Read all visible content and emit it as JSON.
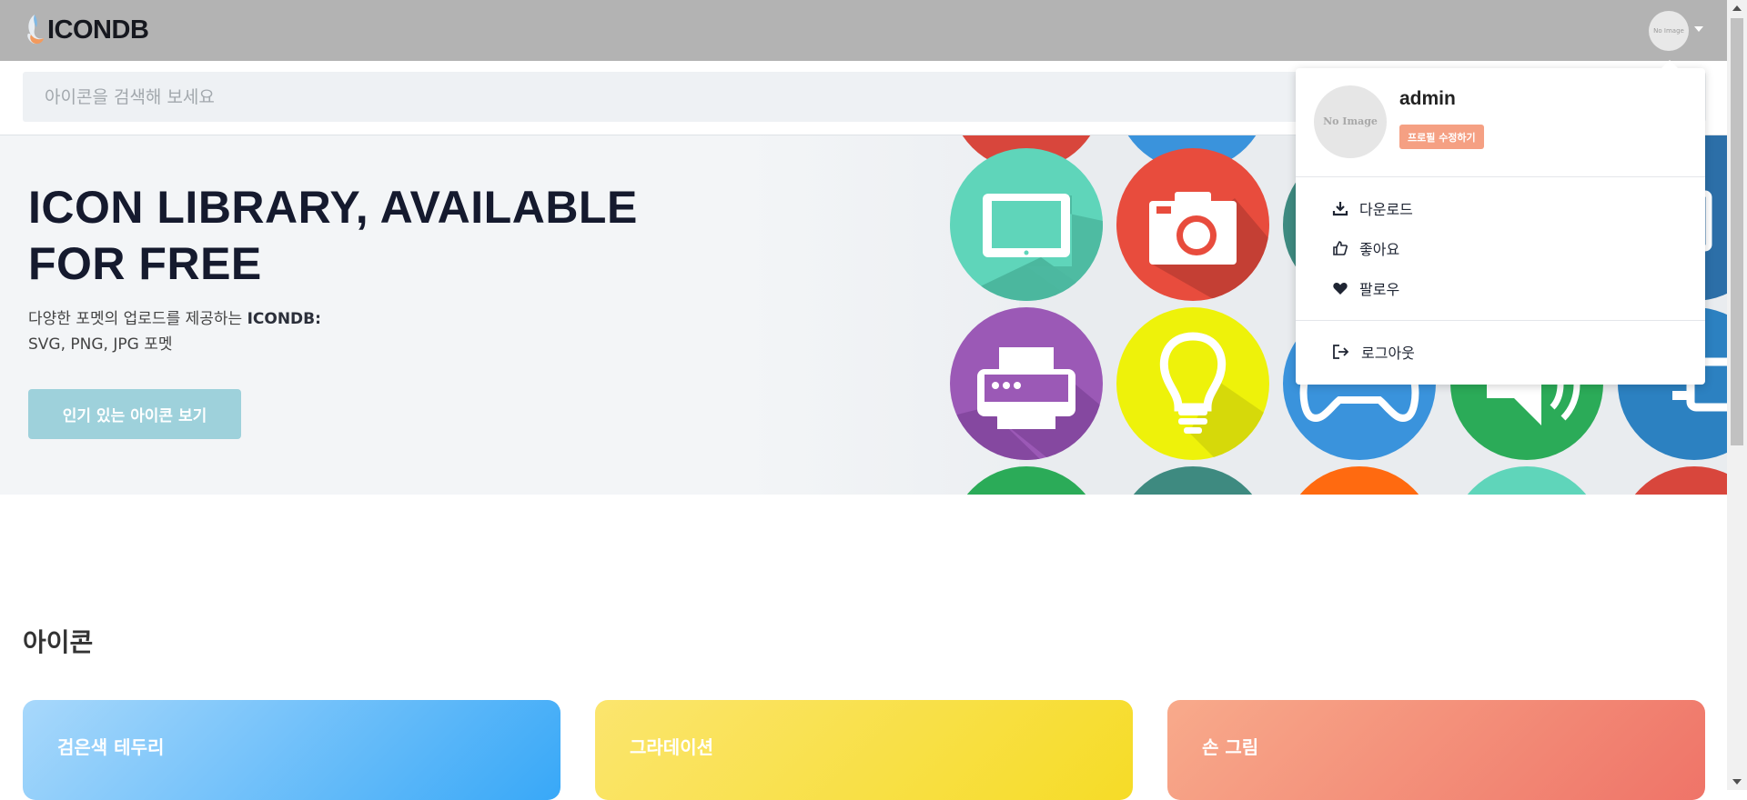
{
  "header": {
    "logo_text": "ICONDB",
    "avatar_text": "No Image"
  },
  "search": {
    "placeholder": "아이콘을 검색해 보세요"
  },
  "hero": {
    "title": "ICON LIBRARY, AVAILABLE FOR FREE",
    "subtitle_prefix": "다양한 포멧의 업로드를 제공하는 ",
    "subtitle_brand": "ICONDB:",
    "subtitle_formats": "SVG, PNG, JPG 포멧",
    "cta_label": "인기 있는 아이콘 보기"
  },
  "user_menu": {
    "avatar_text": "No Image",
    "username": "admin",
    "edit_profile_label": "프로필 수정하기",
    "items": [
      {
        "label": "다운로드",
        "icon": "download-icon"
      },
      {
        "label": "좋아요",
        "icon": "thumbs-up-icon"
      },
      {
        "label": "팔로우",
        "icon": "heart-icon"
      }
    ],
    "logout_label": "로그아웃"
  },
  "section": {
    "title": "아이콘",
    "cards": [
      {
        "label": "검은색 테두리",
        "gradient": [
          "#a8d8fb",
          "#38a8f8"
        ]
      },
      {
        "label": "그라데이션",
        "gradient": [
          "#fbe56e",
          "#f6dc27"
        ]
      },
      {
        "label": "손 그림",
        "gradient": [
          "#f8aa8b",
          "#ef7468"
        ]
      }
    ]
  },
  "colors": {
    "header_bg": "#b3b3b3",
    "cta_bg": "#9ed1db",
    "edit_badge_bg": "#f5a083"
  }
}
